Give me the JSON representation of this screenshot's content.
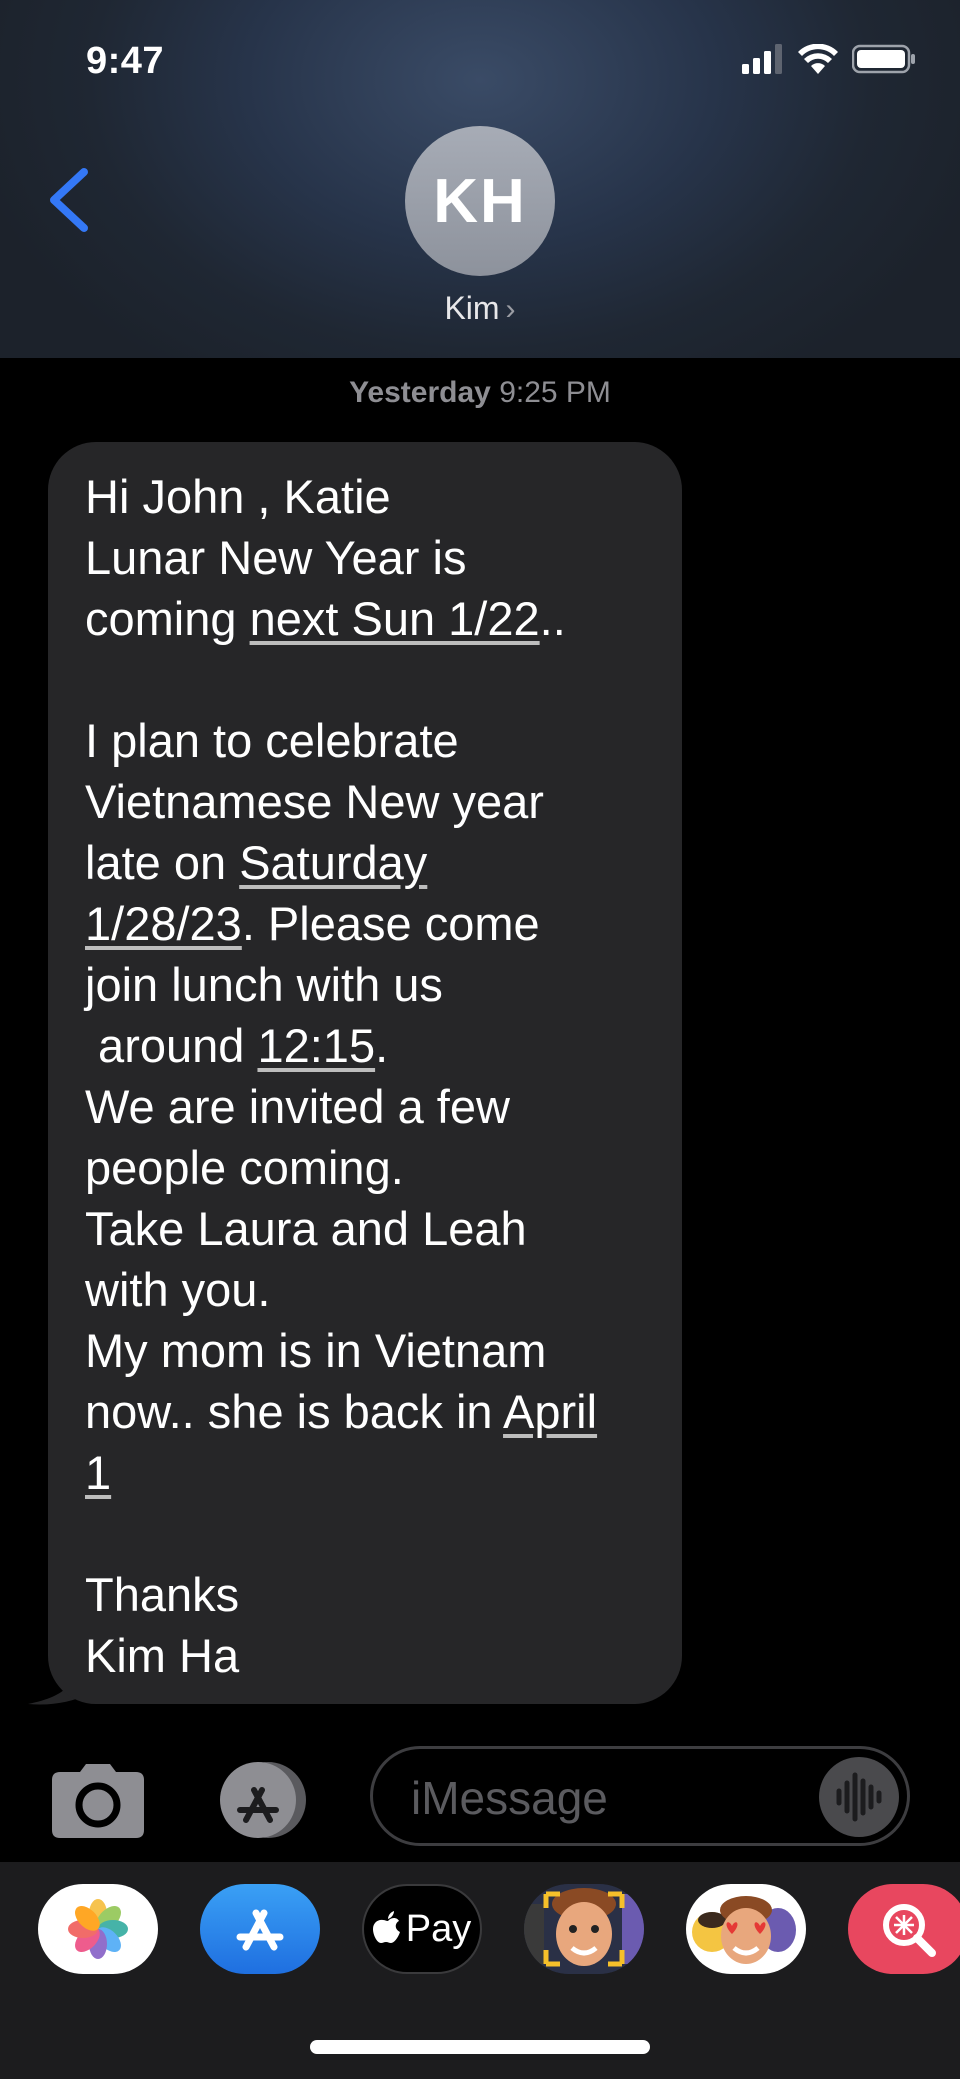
{
  "status_bar": {
    "time": "9:47"
  },
  "contact": {
    "initials": "KH",
    "name": "Kim",
    "chevron": "›"
  },
  "thread": {
    "timestamp_day": "Yesterday",
    "timestamp_time": "9:25 PM"
  },
  "message": {
    "line1": "Hi John , Katie",
    "line2": "Lunar New Year is",
    "line3a": "coming ",
    "line3_link": "next Sun 1/22",
    "line3b": "..",
    "line5": "I plan to celebrate",
    "line6": "Vietnamese New year",
    "line7a": "late on ",
    "line7_link": "Saturday",
    "line8_link": "1/28/23",
    "line8b": ". Please come",
    "line9": "join lunch with us",
    "line10a": " around ",
    "line10_link": "12:15",
    "line10b": ".",
    "line11": "We are invited a few",
    "line12": "people coming.",
    "line13": "Take Laura and Leah",
    "line14": "with you.",
    "line15": "My mom is in Vietnam",
    "line16a": "now.. she is back in ",
    "line16_link": "April",
    "line17_link": "1",
    "line19": "Thanks",
    "line20": "Kim Ha"
  },
  "composer": {
    "placeholder": "iMessage"
  },
  "app_drawer": {
    "apps": [
      "photos-icon",
      "app-store-icon",
      "apple-pay-icon",
      "memoji-icon",
      "memoji-stickers-icon",
      "images-search-icon"
    ],
    "apple_pay_label": "Pay"
  },
  "colors": {
    "accent_blue": "#3478f6",
    "bubble": "#262628",
    "background": "#000000"
  }
}
